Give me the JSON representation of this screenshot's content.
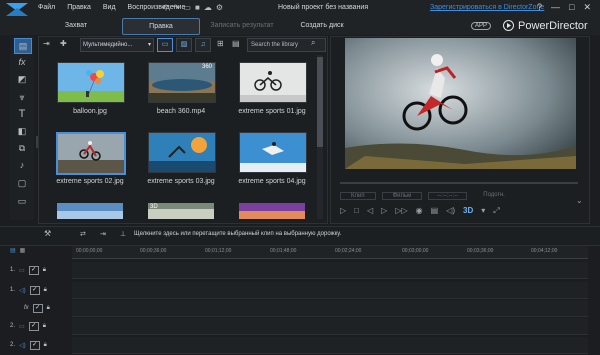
{
  "titlebar": {
    "menu": [
      "Файл",
      "Правка",
      "Вид",
      "Воспроизведение"
    ],
    "project_title": "Новый проект без названия",
    "register_link": "Зарегистрироваться в DirectorZone",
    "window_buttons": [
      "?",
      "—",
      "□",
      "✕"
    ]
  },
  "modes": {
    "capture": "Захват",
    "edit": "Правка",
    "record": "Записать результат",
    "create_disc": "Создать диск",
    "app_badge": "APP",
    "brand": "PowerDirector"
  },
  "tools": [
    "media-room-icon",
    "fx-icon",
    "pip-icon",
    "particle-icon",
    "title-icon",
    "transition-icon",
    "audio-mixing-icon",
    "voiceover-icon",
    "chapter-icon",
    "subtitle-icon"
  ],
  "library": {
    "filter_label": "Мультимедийно...",
    "search_placeholder": "Search the library",
    "items": [
      {
        "name": "balloon.jpg"
      },
      {
        "name": "beach 360.mp4",
        "badge": "360"
      },
      {
        "name": "extreme sports 01.jpg"
      },
      {
        "name": "extreme sports 02.jpg"
      },
      {
        "name": "extreme sports 03.jpg"
      },
      {
        "name": "extreme sports 04.jpg"
      },
      {
        "name": ""
      },
      {
        "name": "",
        "badge": "3D"
      },
      {
        "name": ""
      }
    ]
  },
  "preview": {
    "clip_label": "Клип",
    "movie_label": "Фильм",
    "timecode": "--:--:--:--",
    "fit_label": "Подогн.",
    "mode_3d": "3D"
  },
  "timeline": {
    "hint": "Щелкните здесь или перетащите выбранный клип на выбранную дорожку.",
    "ruler_ticks": [
      "00;00;00;00",
      "00;00;36;00",
      "00;01;12;00",
      "00;01;48;00",
      "00;02;24;00",
      "00;03;00;00",
      "00;03;36;00",
      "00;04;12;00"
    ],
    "tracks": [
      {
        "num": "1.",
        "type": "video"
      },
      {
        "num": "1.",
        "type": "audio"
      },
      {
        "num": "",
        "type": "fx"
      },
      {
        "num": "2.",
        "type": "video"
      },
      {
        "num": "2.",
        "type": "audio"
      }
    ]
  },
  "colors": {
    "accent": "#4a90d8",
    "link": "#3d8fe0",
    "bg": "#1b1d20"
  }
}
